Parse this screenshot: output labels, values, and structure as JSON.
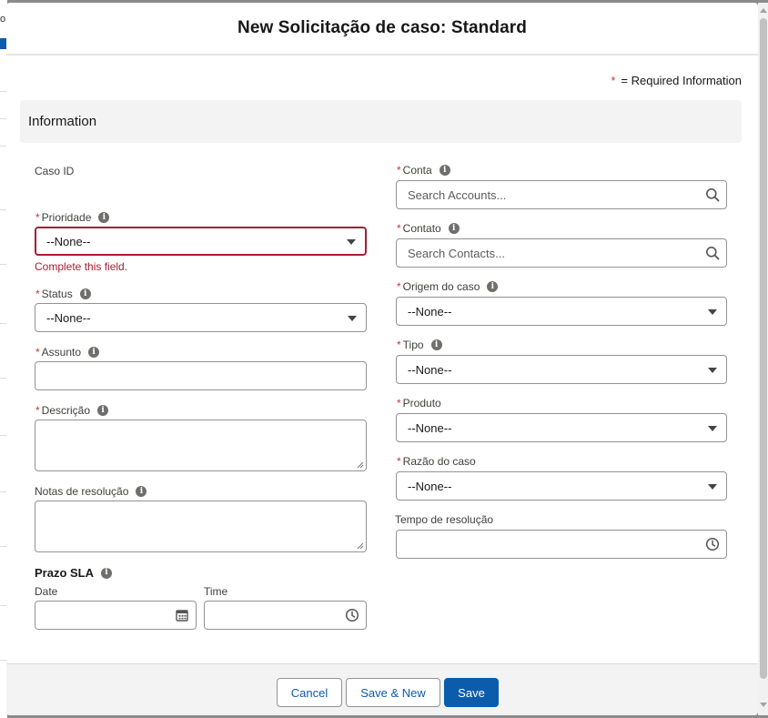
{
  "modal": {
    "title": "New Solicitação de caso: Standard",
    "required_star": "*",
    "required_text": "= Required Information",
    "section_title": "Information"
  },
  "left": {
    "caso_id_label": "Caso ID",
    "prioridade_label": "Prioridade",
    "prioridade_value": "--None--",
    "prioridade_error": "Complete this field.",
    "status_label": "Status",
    "status_value": "--None--",
    "assunto_label": "Assunto",
    "descricao_label": "Descrição",
    "notas_label": "Notas de resolução",
    "prazo_title": "Prazo SLA",
    "date_label": "Date",
    "time_label": "Time"
  },
  "right": {
    "conta_label": "Conta",
    "conta_placeholder": "Search Accounts...",
    "contato_label": "Contato",
    "contato_placeholder": "Search Contacts...",
    "origem_label": "Origem do caso",
    "origem_value": "--None--",
    "tipo_label": "Tipo",
    "tipo_value": "--None--",
    "produto_label": "Produto",
    "produto_value": "--None--",
    "razao_label": "Razão do caso",
    "razao_value": "--None--",
    "tempo_label": "Tempo de resolução"
  },
  "footer": {
    "cancel_label": "Cancel",
    "save_new_label": "Save & New",
    "save_label": "Save"
  },
  "background": {
    "fragment_text": "o"
  },
  "colors": {
    "brand": "#0b5cab",
    "error": "#a81d33",
    "required_star": "#c23934",
    "section_bg": "#f3f3f3"
  },
  "icons": [
    "info-icon",
    "search-icon",
    "chevron-down-icon",
    "calendar-icon",
    "clock-icon"
  ]
}
